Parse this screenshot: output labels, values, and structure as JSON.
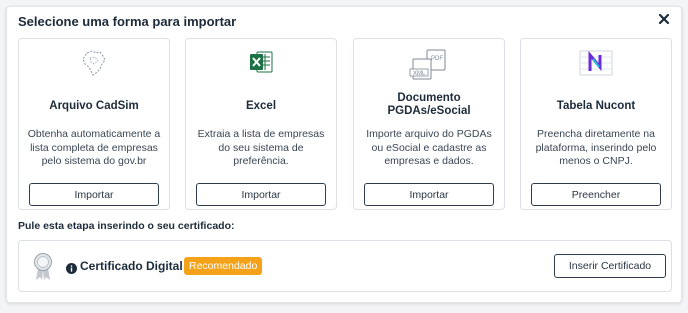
{
  "modal": {
    "title": "Selecione uma forma para importar",
    "close_icon": "close-icon"
  },
  "cards": [
    {
      "icon": "brazil-map-icon",
      "title": "Arquivo CadSim",
      "description": "Obtenha automaticamente a lista completa de empresas pelo sistema do gov.br",
      "button": "Importar"
    },
    {
      "icon": "excel-icon",
      "title": "Excel",
      "description": "Extraia a lista de empresas do seu sistema de preferência.",
      "button": "Importar"
    },
    {
      "icon": "xml-pdf-icon",
      "title": "Documento PGDAs/eSocial",
      "description": "Importe arquivo do PGDAs ou eSocial e cadastre as empresas e dados.",
      "button": "Importar"
    },
    {
      "icon": "nucont-table-icon",
      "title": "Tabela Nucont",
      "description": "Preencha diretamente na plataforma, inserindo pelo menos o CNPJ.",
      "button": "Preencher"
    }
  ],
  "certificate": {
    "heading": "Pule esta etapa inserindo o seu certificado:",
    "label": "Certificado Digital",
    "badge": "Recomendado",
    "button": "Inserir Certificado",
    "medal_icon": "medal-icon",
    "info_icon": "info-icon"
  },
  "colors": {
    "badge": "#f5a21b",
    "excel_green": "#1e7145",
    "nucont_purple": "#6b2bd9"
  }
}
